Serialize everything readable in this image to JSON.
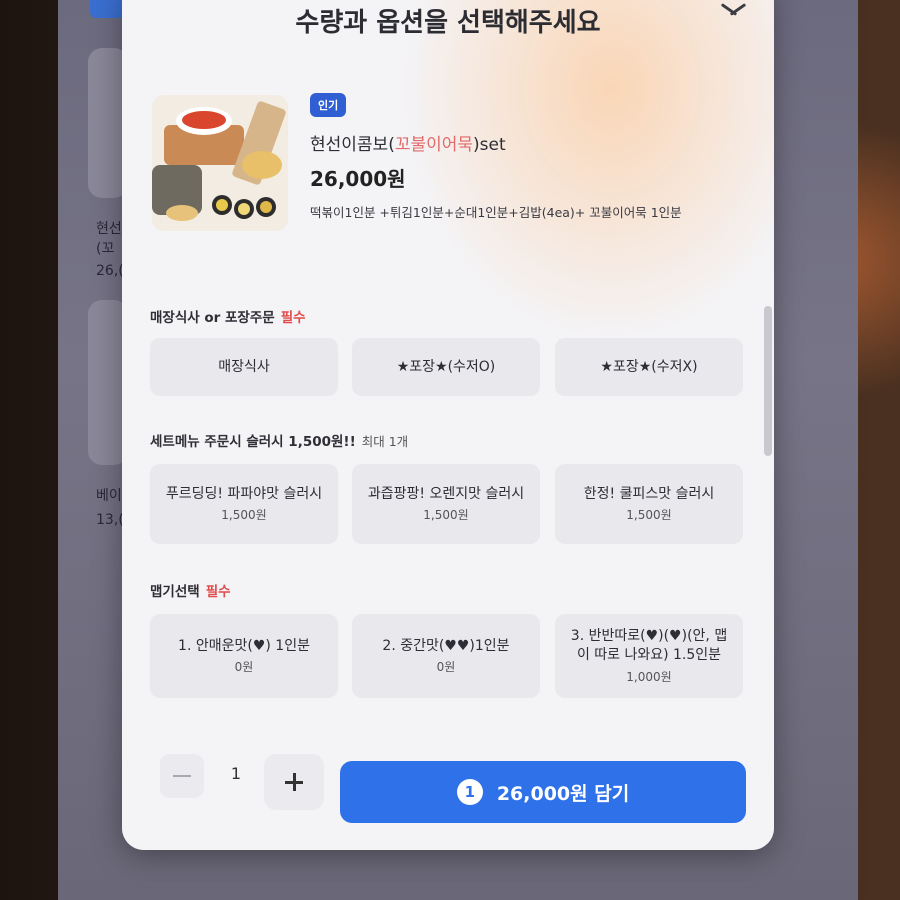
{
  "modal": {
    "title": "수량과 옵션을 선택해주세요"
  },
  "product": {
    "badge": "인기",
    "name_prefix": "현선이콤보(",
    "name_highlight": "꼬불이어묵",
    "name_suffix": ")set",
    "price": "26,000원",
    "description": "떡볶이1인분 +튀김1인분+순대1인분+김밥(4ea)+ 꼬불이어묵 1인분"
  },
  "sections": [
    {
      "title": "매장식사 or 포장주문",
      "required": "필수",
      "options": [
        {
          "label": "매장식사"
        },
        {
          "label": "★포장★(수저O)"
        },
        {
          "label": "★포장★(수저X)"
        }
      ]
    },
    {
      "title": "세트메뉴 주문시 슬러시 1,500원!!",
      "max_note": "최대 1개",
      "options": [
        {
          "label": "푸르딩딩! 파파야맛 슬러시",
          "price": "1,500원"
        },
        {
          "label": "과즙팡팡! 오렌지맛 슬러시",
          "price": "1,500원"
        },
        {
          "label": "한정! 쿨피스맛 슬러시",
          "price": "1,500원"
        }
      ]
    },
    {
      "title": "맵기선택",
      "required": "필수",
      "options": [
        {
          "label": "1. 안매운맛(♥) 1인분",
          "price": "0원"
        },
        {
          "label": "2. 중간맛(♥♥)1인분",
          "price": "0원"
        },
        {
          "label": "3. 반반따로(♥)(♥)(안, 맵이 따로 나와요) 1.5인분",
          "price": "1,000원"
        }
      ]
    }
  ],
  "footer": {
    "quantity": "1",
    "cart_count": "1",
    "cart_label": "26,000원 담기"
  },
  "background": {
    "item1_line1": "현선",
    "item1_line2": "(꼬",
    "item1_price": "26,(",
    "item2_name": "베이",
    "item2_price": "13,("
  },
  "colors": {
    "accent": "#2f71e8",
    "badge": "#2f5fd2",
    "required": "#e04c4c",
    "highlight": "#e26a6a"
  }
}
